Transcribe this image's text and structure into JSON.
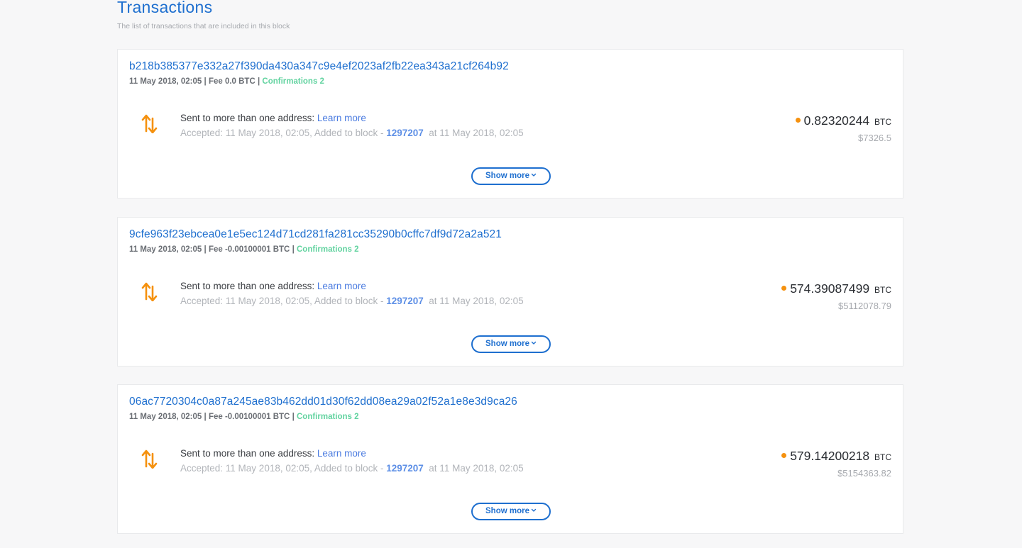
{
  "header": {
    "title": "Transactions",
    "subtitle": "The list of transactions that are included in this block"
  },
  "transactions": [
    {
      "hash": "b218b385377e332a27f390da430a347c9e4ef2023af2fb22ea343a21cf264b92",
      "date": "11 May 2018, 02:05",
      "fee": "Fee 0.0 BTC",
      "confirmations": "Confirmations 2",
      "description": "Sent to more than one address:",
      "learn_more": "Learn more",
      "accepted_prefix": "Accepted: 11 May 2018, 02:05, Added to block -",
      "block": "1297207",
      "accepted_suffix": "at 11 May 2018, 02:05",
      "amount": "0.82320244",
      "unit": "BTC",
      "usd": "$7326.5",
      "show_more": "Show more"
    },
    {
      "hash": "9cfe963f23ebcea0e1e5ec124d71cd281fa281cc35290b0cffc7df9d72a2a521",
      "date": "11 May 2018, 02:05",
      "fee": "Fee -0.00100001 BTC",
      "confirmations": "Confirmations 2",
      "description": "Sent to more than one address:",
      "learn_more": "Learn more",
      "accepted_prefix": "Accepted: 11 May 2018, 02:05, Added to block -",
      "block": "1297207",
      "accepted_suffix": "at 11 May 2018, 02:05",
      "amount": "574.39087499",
      "unit": "BTC",
      "usd": "$5112078.79",
      "show_more": "Show more"
    },
    {
      "hash": "06ac7720304c0a87a245ae83b462dd01d30f62dd08ea29a02f52a1e8e3d9ca26",
      "date": "11 May 2018, 02:05",
      "fee": "Fee -0.00100001 BTC",
      "confirmations": "Confirmations 2",
      "description": "Sent to more than one address:",
      "learn_more": "Learn more",
      "accepted_prefix": "Accepted: 11 May 2018, 02:05, Added to block -",
      "block": "1297207",
      "accepted_suffix": "at 11 May 2018, 02:05",
      "amount": "579.14200218",
      "unit": "BTC",
      "usd": "$5154363.82",
      "show_more": "Show more"
    }
  ],
  "icons": {
    "transfer": "arrows-up-down-icon",
    "amount_dot": "status-dot-icon",
    "chevron": "chevron-down-icon"
  },
  "colors": {
    "accent": "#1e6fcf",
    "confirmations": "#62d3a0",
    "icon_orange": "#f5910e",
    "block_link": "#5d8fe6"
  }
}
